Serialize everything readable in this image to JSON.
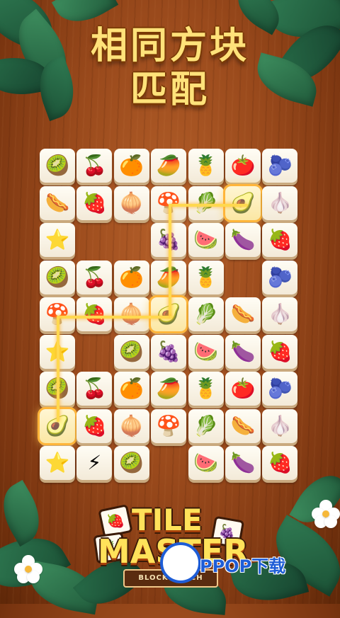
{
  "header": {
    "title_line1": "相同方块",
    "title_line2": "匹配"
  },
  "logo": {
    "line1": "TILE",
    "line2": "MASTER",
    "subtitle": "BLOCK MATCH",
    "tiles": [
      "🍓",
      "🍍",
      "🍇"
    ]
  },
  "watermark": {
    "text": "PPOP下载"
  },
  "colors": {
    "wood": "#9a4a1c",
    "tile": "#fffdf5",
    "highlight": "#ffd84f",
    "title": "#ffe27a"
  },
  "tiles": [
    {
      "icon": "kiwi-icon",
      "glyph": "🥝"
    },
    {
      "icon": "cherry-icon",
      "glyph": "🍒"
    },
    {
      "icon": "orange-icon",
      "glyph": "🍊"
    },
    {
      "icon": "papaya-icon",
      "glyph": "🥭"
    },
    {
      "icon": "pineapple-icon",
      "glyph": "🍍"
    },
    {
      "icon": "tomato-icon",
      "glyph": "🍅"
    },
    {
      "icon": "blueberry-icon",
      "glyph": "🫐"
    },
    {
      "icon": "sausage-icon",
      "glyph": "🌭"
    },
    {
      "icon": "strawberry-icon",
      "glyph": "🍓"
    },
    {
      "icon": "onion-icon",
      "glyph": "🧅"
    },
    {
      "icon": "mushroom-icon",
      "glyph": "🍄"
    },
    {
      "icon": "lettuce-icon",
      "glyph": "🥬"
    },
    {
      "icon": "avocado-icon",
      "glyph": "🥑"
    },
    {
      "icon": "radish-icon",
      "glyph": "🧄"
    },
    {
      "icon": "starfruit-icon",
      "glyph": "⭐"
    },
    {
      "icon": "grape-icon",
      "glyph": "🍇"
    },
    {
      "icon": "watermelon-icon",
      "glyph": "🍉"
    },
    {
      "icon": "eggplant-icon",
      "glyph": "🍆"
    },
    {
      "icon": "lightning-icon",
      "glyph": "⚡"
    }
  ]
}
